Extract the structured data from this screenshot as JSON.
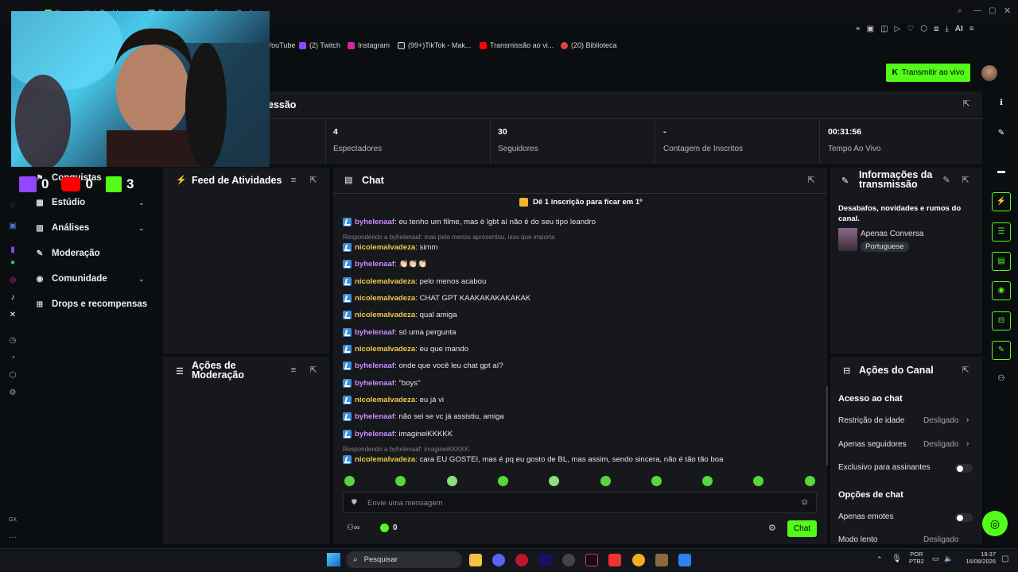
{
  "browser": {
    "tabs": [
      {
        "label": "Stream - Kick Dashbo"
      },
      {
        "label": "Pomfy • Filmes e Séries O"
      }
    ],
    "bookmarks": [
      {
        "label": "YouTube"
      },
      {
        "label": "(2) Twitch"
      },
      {
        "label": "Instagram"
      },
      {
        "label": "(99+)TikTok - Mak..."
      },
      {
        "label": "Transmissão ao vi..."
      },
      {
        "label": "(20) Biblioteca"
      }
    ],
    "ai_label": "AI"
  },
  "header": {
    "live_button": "Transmitir ao vivo",
    "session_title": "essão"
  },
  "stats": [
    {
      "value": "4",
      "label": "Espectadores"
    },
    {
      "value": "30",
      "label": "Seguidores"
    },
    {
      "value": "-",
      "label": "Contagem de Inscritos"
    },
    {
      "value": "00:31:56",
      "label": "Tempo Ao Vivo"
    }
  ],
  "webcam_overlay": {
    "counters": [
      {
        "platform": "twitch",
        "value": "0"
      },
      {
        "platform": "youtube",
        "value": "0"
      },
      {
        "platform": "kick",
        "value": "3"
      }
    ]
  },
  "sidebar": {
    "items": [
      {
        "label": "Conquistas"
      },
      {
        "label": "Estúdio"
      },
      {
        "label": "Análises"
      },
      {
        "label": "Moderação"
      },
      {
        "label": "Comunidade"
      },
      {
        "label": "Drops e recompensas"
      }
    ]
  },
  "feed": {
    "title": "Feed de Atividades"
  },
  "modactions": {
    "title_line1": "Ações de",
    "title_line2": "Moderação"
  },
  "chat": {
    "title": "Chat",
    "pinned": "Dê 1 inscrição para ficar em 1º",
    "messages": [
      {
        "user": "byhelenaaf",
        "text": ": eu tenho um filme, mas é lgbt aí não é do seu tipo leandro"
      },
      {
        "user": "nicolemalvadeza",
        "text": ": simm",
        "reply": "Respondendo a byhelenaaf: mas pelo menos apresentou, isso que importa"
      },
      {
        "user": "byhelenaaf",
        "text": ": 👏🏻👏🏻👏🏻"
      },
      {
        "user": "nicolemalvadeza",
        "text": ": pelo menos acabou"
      },
      {
        "user": "nicolemalvadeza",
        "text": ": CHAT GPT KAAKAKAKAKAKAK"
      },
      {
        "user": "nicolemalvadeza",
        "text": ": qual amiga"
      },
      {
        "user": "byhelenaaf",
        "text": ": só uma pergunta"
      },
      {
        "user": "nicolemalvadeza",
        "text": ": eu que mando"
      },
      {
        "user": "byhelenaaf",
        "text": ": onde que você leu chat gpt aí?"
      },
      {
        "user": "byhelenaaf",
        "text": ": \"boys\""
      },
      {
        "user": "nicolemalvadeza",
        "text": ": eu já vi"
      },
      {
        "user": "byhelenaaf",
        "text": ": não sei se vc já assistiu, amiga"
      },
      {
        "user": "byhelenaaf",
        "text": ": imagineiKKKKK"
      },
      {
        "user": "nicolemalvadeza",
        "text": ": cara EU GOSTEI, mas é pq eu gosto de BL, mas assim, sendo sincera, não é tão tão boa",
        "reply": "Respondendo a byhelenaaf: imagineiKKKKK"
      }
    ],
    "input_placeholder": "Envie uma mensagem",
    "points": "0",
    "send_label": "Chat"
  },
  "stream_info": {
    "title_line1": "Informações da",
    "title_line2": "transmissão",
    "description": "Desabafos, novidades e rumos do canal.",
    "category": "Apenas Conversa",
    "language": "Portuguese"
  },
  "channel_actions": {
    "title": "Ações do Canal",
    "chat_access_title": "Acesso ao chat",
    "age_restriction": {
      "label": "Restrição de idade",
      "value": "Desligado"
    },
    "followers_only": {
      "label": "Apenas seguidores",
      "value": "Desligado"
    },
    "subs_only": {
      "label": "Exclusivo para assinantes",
      "enabled": false
    },
    "chat_options_title": "Opções de chat",
    "emotes_only": {
      "label": "Apenas emotes",
      "enabled": false
    },
    "slow_mode": {
      "label": "Modo lento",
      "value": "Desligado"
    }
  },
  "taskbar": {
    "search_label": "Pesquisar",
    "lang_line1": "POR",
    "lang_line2": "PTB2",
    "time": "19:37",
    "date": "16/08/2026"
  },
  "colors": {
    "accent": "#53fc18",
    "panel": "#16181c",
    "bg": "#0b0e11",
    "purple_user": "#c98cff",
    "yellow_user": "#f0c84a"
  }
}
